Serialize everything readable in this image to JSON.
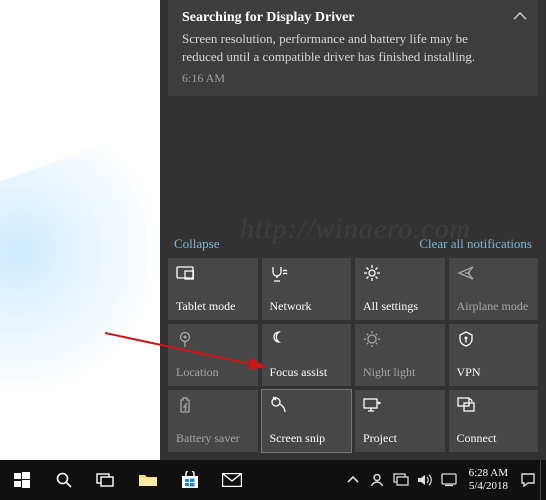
{
  "notification": {
    "title": "Searching for Display Driver",
    "body": "Screen resolution, performance and battery life may be reduced until a compatible driver has finished installing.",
    "time": "6:16 AM"
  },
  "actions": {
    "collapse": "Collapse",
    "clear_all": "Clear all notifications"
  },
  "quickActions": [
    {
      "label": "Tablet mode",
      "icon": "tablet",
      "off": false
    },
    {
      "label": "Network",
      "icon": "network",
      "off": false
    },
    {
      "label": "All settings",
      "icon": "settings",
      "off": false
    },
    {
      "label": "Airplane mode",
      "icon": "airplane",
      "off": true
    },
    {
      "label": "Location",
      "icon": "location",
      "off": true
    },
    {
      "label": "Focus assist",
      "icon": "focus",
      "off": false
    },
    {
      "label": "Night light",
      "icon": "nightlight",
      "off": true
    },
    {
      "label": "VPN",
      "icon": "vpn",
      "off": false
    },
    {
      "label": "Battery saver",
      "icon": "battery",
      "off": true
    },
    {
      "label": "Screen snip",
      "icon": "snip",
      "off": false
    },
    {
      "label": "Project",
      "icon": "project",
      "off": false
    },
    {
      "label": "Connect",
      "icon": "connect",
      "off": false
    }
  ],
  "highlightedIndex": 9,
  "clock": {
    "time": "6:28 AM",
    "date": "5/4/2018"
  },
  "watermark": "http://winaero.com"
}
